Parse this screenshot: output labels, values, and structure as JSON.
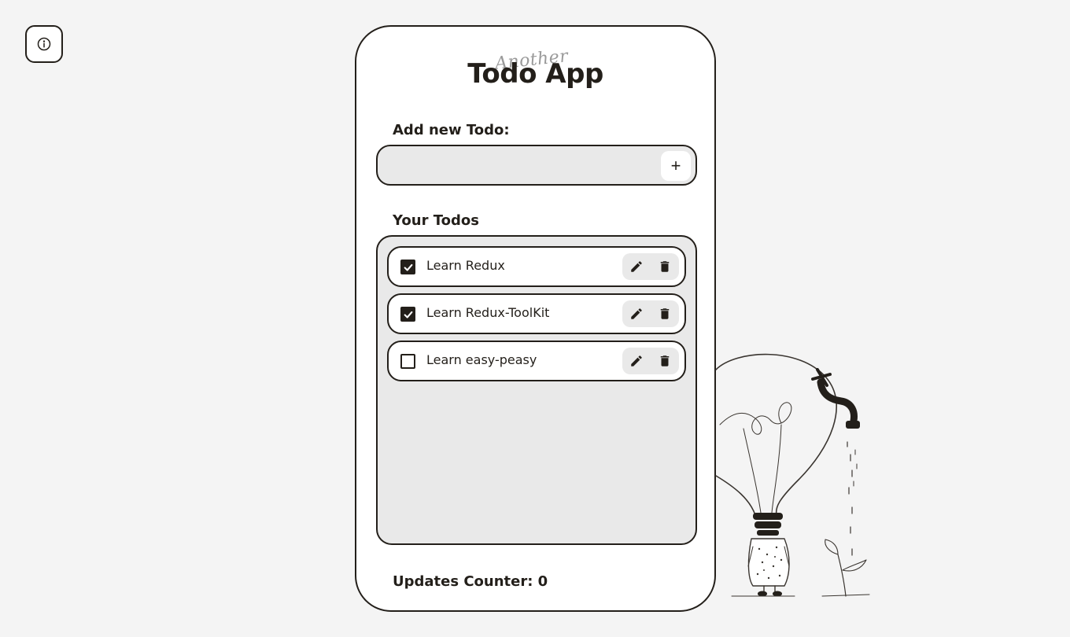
{
  "app": {
    "title_small": "Another",
    "title_main": "Todo App"
  },
  "add_section": {
    "label": "Add new Todo:",
    "input_value": "",
    "input_placeholder": "",
    "add_button_label": "+"
  },
  "todos_section": {
    "label": "Your Todos",
    "items": [
      {
        "text": "Learn Redux",
        "checked": true
      },
      {
        "text": "Learn Redux-ToolKit",
        "checked": true
      },
      {
        "text": "Learn easy-peasy",
        "checked": false
      }
    ]
  },
  "footer": {
    "counter_label": "Updates Counter: 0"
  },
  "icons": {
    "info": "info-icon",
    "edit": "pencil-icon",
    "delete": "trash-icon",
    "check": "checkmark-icon"
  },
  "colors": {
    "ink": "#231f1a",
    "background": "#f4f4f4",
    "panel": "#e9e9e9",
    "card": "#ffffff",
    "subtitle": "#9a9a9a"
  }
}
